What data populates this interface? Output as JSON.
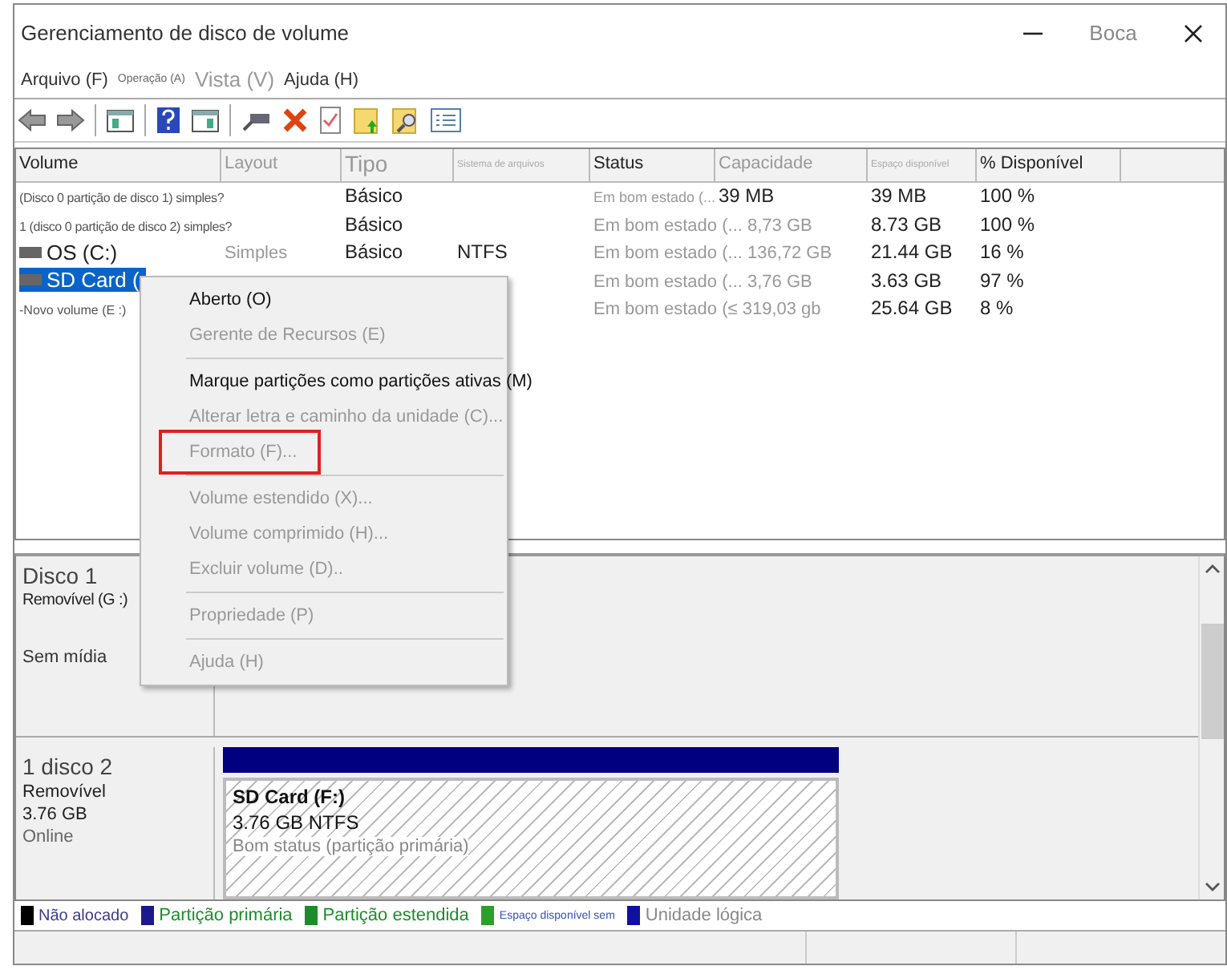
{
  "window": {
    "title": "Gerenciamento de disco de volume",
    "caption_text": "Boca"
  },
  "menu_bar": [
    {
      "label": "Arquivo (F)",
      "disabled": false
    },
    {
      "label": "Operação (A)",
      "disabled": false
    },
    {
      "label": "Vista (V)",
      "disabled": true
    },
    {
      "label": "Ajuda (H)",
      "disabled": false
    }
  ],
  "table": {
    "columns": [
      "Volume",
      "Layout",
      "Tipo",
      "Sistema de arquivos",
      "Status",
      "Capacidade",
      "Espaço disponível",
      "% Disponível"
    ],
    "rows": [
      {
        "selected": false,
        "cells": [
          "(Disco 0 partição de disco 1) simples?",
          "",
          "Básico",
          "",
          "Em bom estado (...",
          "39 MB",
          "39 MB",
          "100 %"
        ]
      },
      {
        "selected": false,
        "cells": [
          "1 (disco 0 partição de disco 2) simples?",
          "",
          "Básico",
          "",
          "Em bom estado (... 8,73 GB",
          "",
          "8.73 GB",
          "100 %"
        ]
      },
      {
        "selected": false,
        "cells": [
          "OS (C:)",
          "Simples",
          "Básico",
          "NTFS",
          "Em bom estado (... 136,72 GB",
          "",
          "21.44 GB",
          "16 %"
        ]
      },
      {
        "selected": true,
        "cells": [
          "SD Card (",
          "",
          "",
          "",
          "Em bom estado (... 3,76 GB",
          "",
          "3.63 GB",
          "97 %"
        ]
      },
      {
        "selected": false,
        "cells": [
          "-Novo volume (E :)",
          "",
          "",
          "",
          "Em bom estado (≤ 319,03 gb",
          "",
          "25.64 GB",
          "8 %"
        ]
      }
    ]
  },
  "context_menu": [
    {
      "kind": "item",
      "label": "Aberto (O)",
      "disabled": false,
      "outlined": false
    },
    {
      "kind": "item",
      "label": "Gerente de Recursos (E)",
      "disabled": true,
      "outlined": false
    },
    {
      "kind": "separator"
    },
    {
      "kind": "item",
      "label": "Marque partições como partições ativas (M)",
      "disabled": false,
      "outlined": false
    },
    {
      "kind": "item",
      "label": "Alterar letra e caminho da unidade (C)...",
      "disabled": true,
      "outlined": false
    },
    {
      "kind": "item",
      "label": "Formato (F)...",
      "disabled": true,
      "outlined": true
    },
    {
      "kind": "separator"
    },
    {
      "kind": "item",
      "label": "Volume estendido (X)...",
      "disabled": true,
      "outlined": false
    },
    {
      "kind": "item",
      "label": "Volume comprimido (H)...",
      "disabled": true,
      "outlined": false
    },
    {
      "kind": "item",
      "label": "Excluir volume (D)..",
      "disabled": true,
      "outlined": false
    },
    {
      "kind": "separator"
    },
    {
      "kind": "item",
      "label": "Propriedade (P)",
      "disabled": true,
      "outlined": false
    },
    {
      "kind": "separator"
    },
    {
      "kind": "item",
      "label": "Ajuda (H)",
      "disabled": true,
      "outlined": false
    }
  ],
  "disks": [
    {
      "name": "Disco 1",
      "lines": [
        "Removível (G :)",
        "Sem mídia"
      ]
    },
    {
      "name": "1 disco 2",
      "lines": [
        "Removível",
        "3.76 GB",
        "Online"
      ],
      "partitions": [
        {
          "name": "SD Card  (F:)",
          "size": "3.76 GB NTFS",
          "status": "Bom status (partição primária)"
        }
      ]
    }
  ],
  "legend": [
    {
      "label": "Não alocado",
      "color": "#000000"
    },
    {
      "label": "Partição primária",
      "color": "#1a1a8c"
    },
    {
      "label": "Partição estendida",
      "color": "#1e8c2a"
    },
    {
      "label": "Espaço disponível sem",
      "color": "#2ca02c"
    },
    {
      "label": "Unidade lógica",
      "color": "#1010a0"
    }
  ]
}
